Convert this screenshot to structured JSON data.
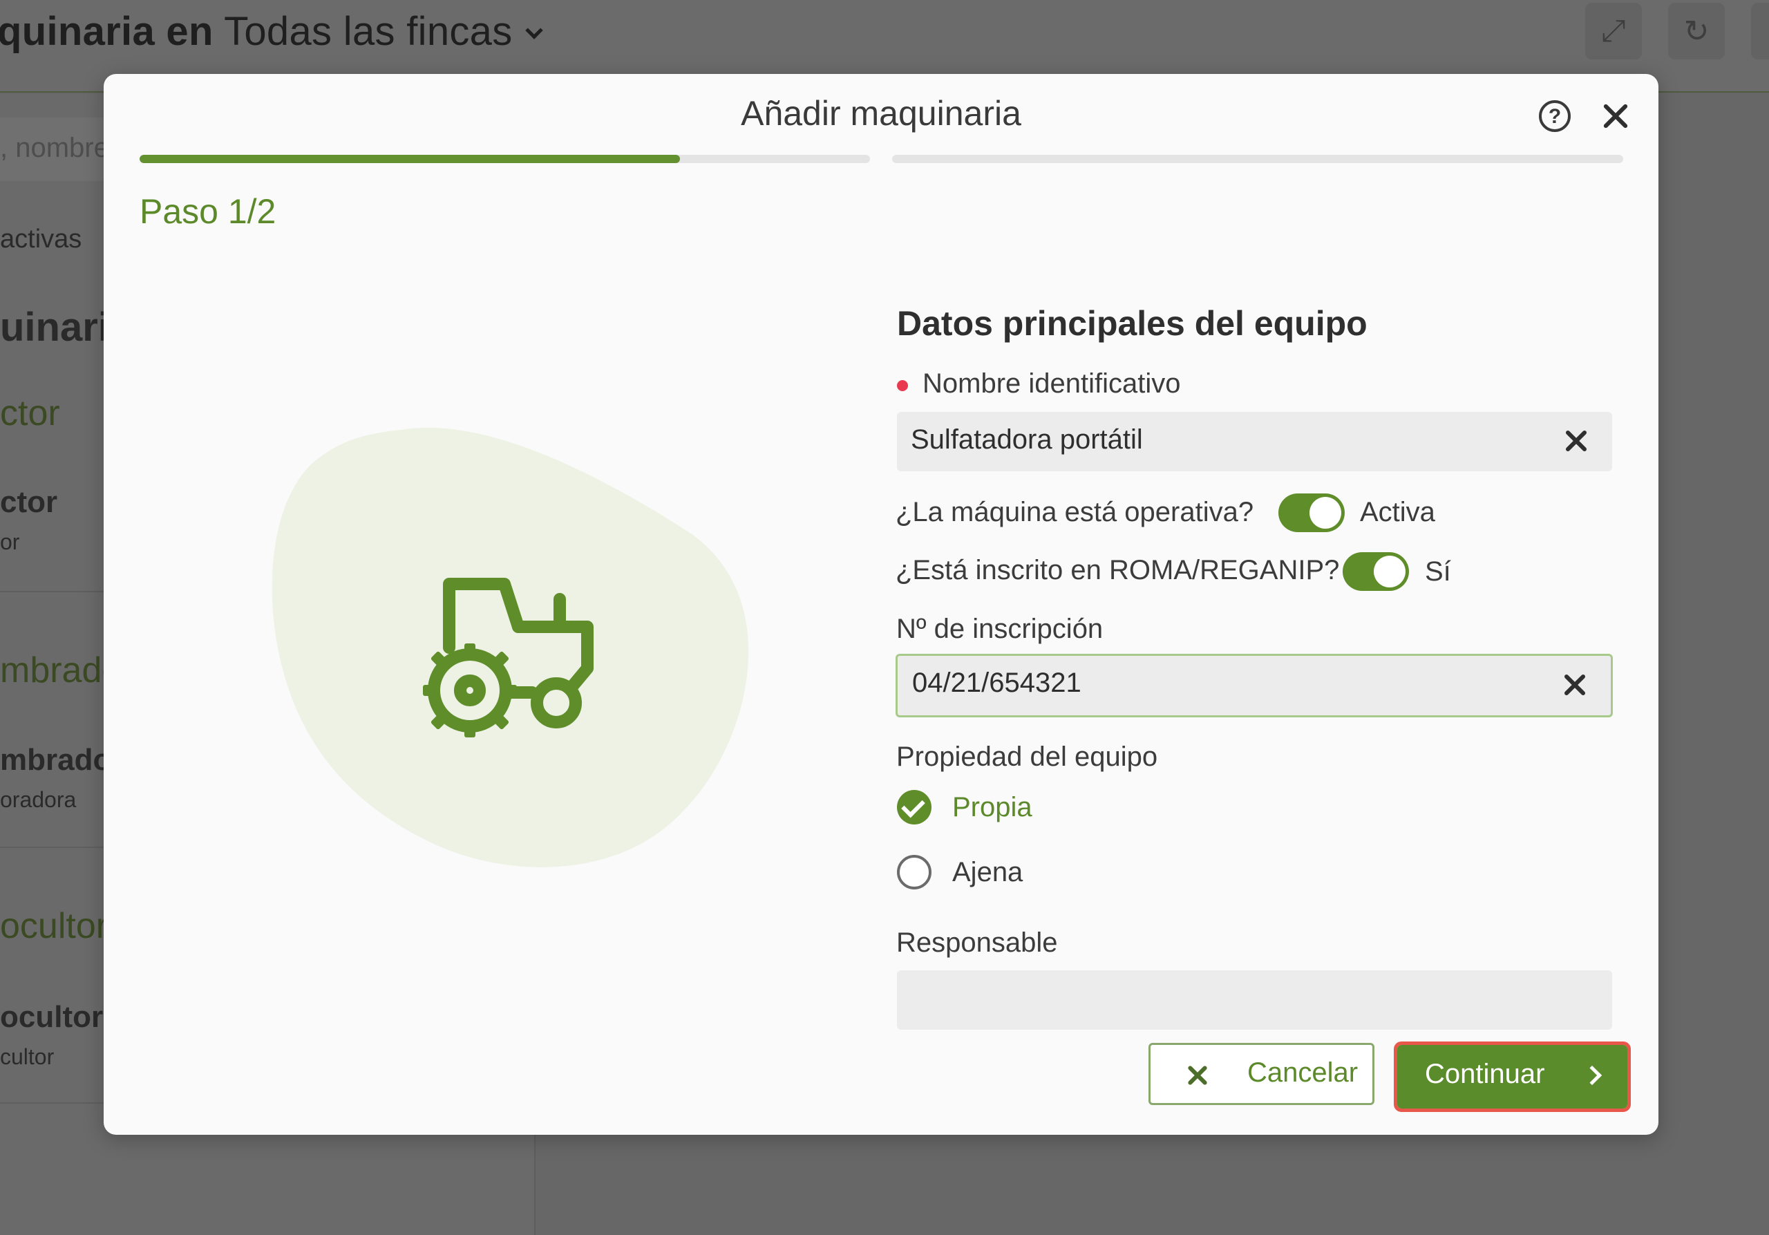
{
  "background": {
    "title_bold": "quinaria en",
    "title_rest": "Todas las fincas",
    "search_placeholder": ", nombre",
    "sidebar_texts": {
      "activas": "activas",
      "heading": "uinaria",
      "item1_group": "ctor",
      "item1_name": "ctor",
      "item1_sub": "or",
      "item2_group": "mbrado",
      "item2_name": "mbrador",
      "item2_sub": "oradora",
      "item3_group": "ocultor",
      "item3_name": "ocultor",
      "item3_sub": "cultor"
    }
  },
  "modal": {
    "title": "Añadir maquinaria",
    "step_label": "Paso 1/2",
    "progress": {
      "step1_fraction": 0.74,
      "step2_fraction": 0.0
    },
    "section_title": "Datos principales del equipo",
    "name_field": {
      "label": "Nombre identificativo",
      "value": "Sulfatadora portátil"
    },
    "operativa": {
      "label": "¿La máquina está operativa?",
      "state_text": "Activa",
      "on": true
    },
    "roma": {
      "label": "¿Está inscrito en ROMA/REGANIP?",
      "state_text": "Sí",
      "on": true
    },
    "inscripcion_field": {
      "label": "Nº de inscripción",
      "value": "04/21/654321"
    },
    "propiedad": {
      "label": "Propiedad del equipo",
      "options": [
        {
          "label": "Propia",
          "selected": true
        },
        {
          "label": "Ajena",
          "selected": false
        }
      ]
    },
    "responsable_field": {
      "label": "Responsable",
      "value": ""
    },
    "buttons": {
      "cancel": "Cancelar",
      "continue": "Continuar"
    }
  },
  "colors": {
    "accent_green": "#5e8d2a",
    "required_dot": "#e8394f",
    "highlight_outline": "#e8584a",
    "blob": "#edf2e4"
  }
}
